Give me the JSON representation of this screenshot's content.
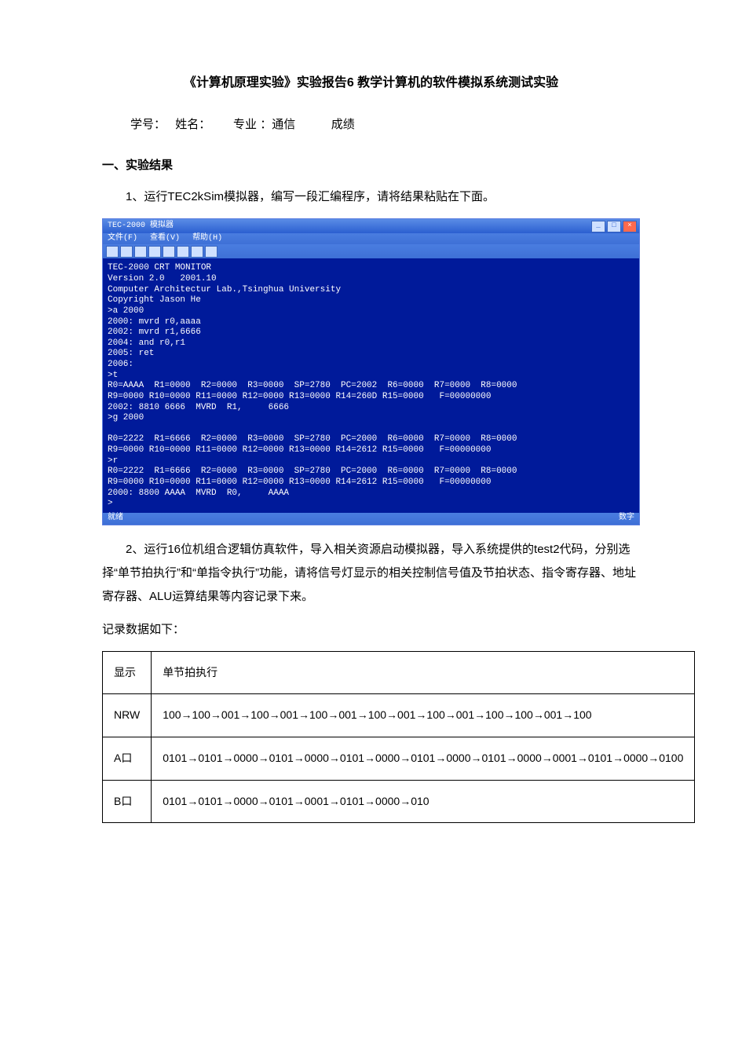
{
  "title": "《计算机原理实验》实验报告6   教学计算机的软件模拟系统测试实验",
  "info": {
    "id_label": "学号：",
    "name_label": "姓名：",
    "major_label": "专业 ：通信",
    "score_label": "成绩"
  },
  "section1_head": "一、实验结果",
  "para1": "1、运行TEC2kSim模拟器，编写一段汇编程序，请将结果粘贴在下面。",
  "term": {
    "title": "TEC-2000 模拟器",
    "menu": [
      "文件(F)",
      "查看(V)",
      "帮助(H)"
    ],
    "body": "TEC-2000 CRT MONITOR\nVersion 2.0   2001.10\nComputer Architectur Lab.,Tsinghua University\nCopyright Jason He\n>a 2000\n2000: mvrd r0,aaaa\n2002: mvrd r1,6666\n2004: and r0,r1\n2005: ret\n2006:\n>t\nR0=AAAA  R1=0000  R2=0000  R3=0000  SP=2780  PC=2002  R6=0000  R7=0000  R8=0000\nR9=0000 R10=0000 R11=0000 R12=0000 R13=0000 R14=260D R15=0000   F=00000000\n2002: 8810 6666  MVRD  R1,     6666\n>g 2000\n\nR0=2222  R1=6666  R2=0000  R3=0000  SP=2780  PC=2000  R6=0000  R7=0000  R8=0000\nR9=0000 R10=0000 R11=0000 R12=0000 R13=0000 R14=2612 R15=0000   F=00000000\n>r\nR0=2222  R1=6666  R2=0000  R3=0000  SP=2780  PC=2000  R6=0000  R7=0000  R8=0000\nR9=0000 R10=0000 R11=0000 R12=0000 R13=0000 R14=2612 R15=0000   F=00000000\n2000: 8800 AAAA  MVRD  R0,     AAAA\n>",
    "status_left": "就绪",
    "status_right": "数字"
  },
  "para2": "2、运行16位机组合逻辑仿真软件，导入相关资源启动模拟器，导入系统提供的test2代码，分别选择“单节拍执行”和“单指令执行”功能，请将信号灯显示的相关控制信号值及节拍状态、指令寄存器、地址寄存器、ALU运算结果等内容记录下来。",
  "para3": "记录数据如下：",
  "table": {
    "head": [
      "显示",
      "单节拍执行"
    ],
    "rows": [
      [
        "NRW",
        "100→100→001→100→001→100→001→100→001→100→001→100→100→001→100"
      ],
      [
        "A口",
        "0101→0101→0000→0101→0000→0101→0000→0101→0000→0101→0000→0001→0101→0000→0100"
      ],
      [
        "B口",
        "0101→0101→0000→0101→0001→0101→0000→010"
      ]
    ]
  }
}
